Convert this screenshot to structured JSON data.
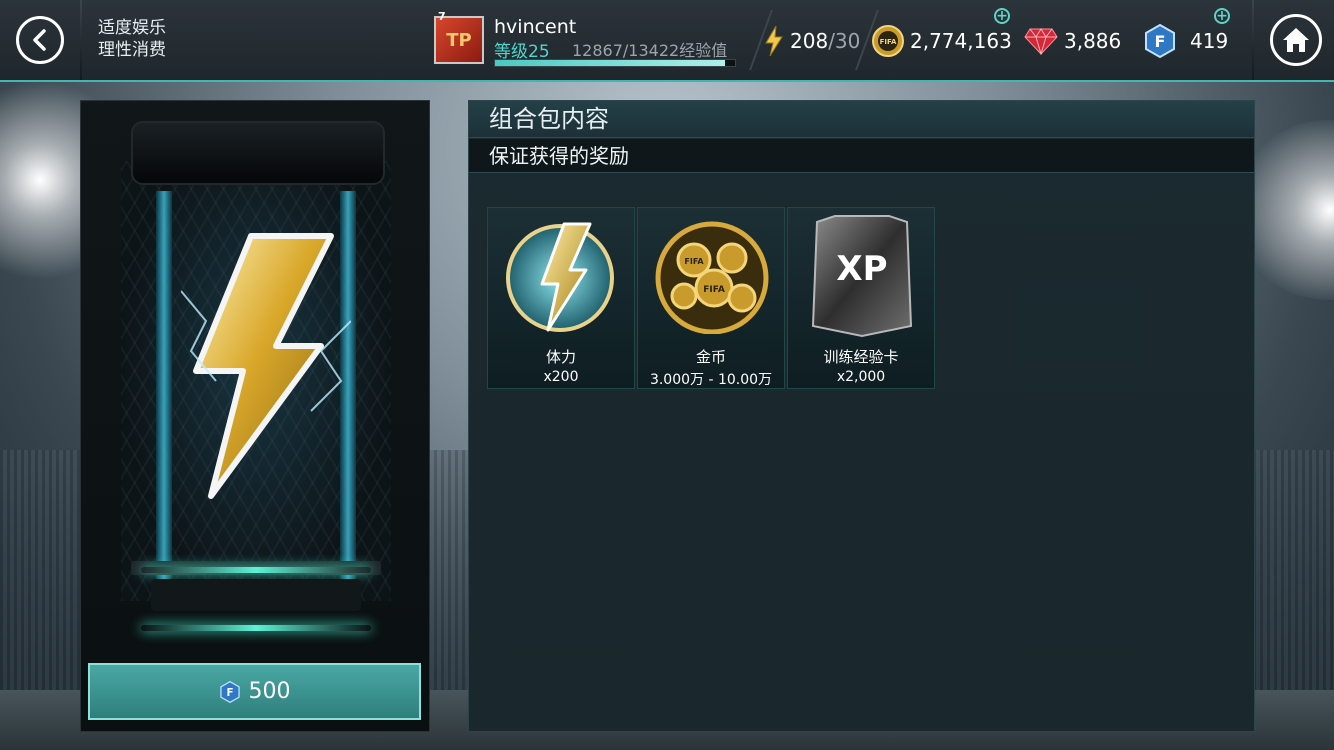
{
  "header": {
    "back_icon": "chevron-left-icon",
    "slogan_line1": "适度娱乐",
    "slogan_line2": "理性消费",
    "avatar_level": "7",
    "username": "hvincent",
    "level_label": "等级25",
    "xp_text": "12867/13422经验值",
    "xp_progress": 0.959,
    "stamina_value": "208",
    "stamina_max": "/30",
    "coins": "2,774,163",
    "gems": "3,886",
    "fifa_points": "419",
    "home_icon": "home-icon"
  },
  "pack": {
    "price": "500",
    "currency_icon": "fifa-points-icon"
  },
  "content": {
    "title": "组合包内容",
    "subtitle": "保证获得的奖励",
    "rewards": [
      {
        "name": "体力",
        "qty": "x200",
        "icon": "stamina-bolt-icon"
      },
      {
        "name": "金币",
        "qty": "3.000万 - 10.00万",
        "icon": "coins-icon"
      },
      {
        "name": "训练经验卡",
        "qty": "x2,000",
        "icon": "xp-card-icon"
      }
    ]
  },
  "colors": {
    "accent": "#4fd6cf",
    "price_button": "#3a918d",
    "panel": "#1b2a30"
  }
}
